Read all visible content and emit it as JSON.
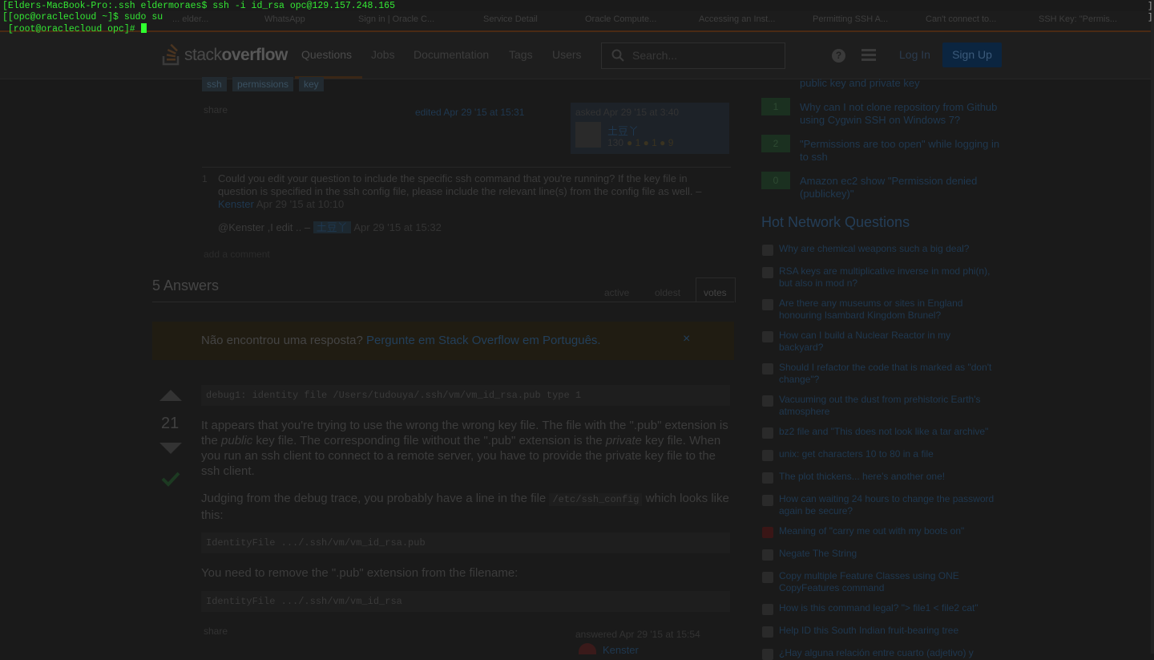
{
  "browser": {
    "tabs": [
      "... elder...",
      "WhatsApp",
      "Sign in | Oracle C...",
      "Service Detail",
      "Oracle Compute...",
      "Accessing an Inst...",
      "Permitting SSH A...",
      "Can't connect to...",
      "SSH Key: \"Permis..."
    ]
  },
  "so": {
    "logo_a": "stack",
    "logo_b": "overflow",
    "nav": [
      "Questions",
      "Jobs",
      "Documentation",
      "Tags",
      "Users"
    ],
    "search_placeholder": "Search...",
    "help_icon": "?",
    "login": "Log In",
    "signup": "Sign Up",
    "tags": [
      "ssh",
      "permissions",
      "key"
    ],
    "share": "share",
    "edited": "edited Apr 29 '15 at 15:31",
    "asked": "asked Apr 29 '15 at 3:40",
    "asker_name": "土豆丫",
    "asker_rep": "130",
    "asker_badges": "● 1  ● 1  ● 9",
    "comments": [
      {
        "score": "1",
        "text": "Could you edit your question to include the specific ssh command that you're running? If the key file in question is specified in the ssh config file, please include the relevant line(s) from the config file as well. –",
        "user": "Kenster",
        "time": "Apr 29 '15 at 10:10"
      },
      {
        "score": "",
        "text": "@Kenster ,I edit .. –",
        "user": "土豆丫",
        "time": "Apr 29 '15 at 15:32"
      }
    ],
    "add_comment": "add a comment",
    "answers_heading": "5 Answers",
    "sort": [
      "active",
      "oldest",
      "votes"
    ],
    "pt_text": "Não encontrou uma resposta?",
    "pt_link": "Pergunte em Stack Overflow em Português.",
    "pt_close": "×",
    "answer": {
      "votes": "21",
      "code1": "debug1: identity file /Users/tudouya/.ssh/vm/vm_id_rsa.pub type 1",
      "p1_a": "It appears that you're trying to use the wrong the wrong key file. The file with the \".pub\" extension is the ",
      "p1_b": "public",
      "p1_c": " key file. The corresponding file without the \".pub\" extension is the ",
      "p1_d": "private",
      "p1_e": " key file. When you run an ssh client to connect to a remote server, you have to provide the private key file to the ssh client.",
      "p2_a": "Judging from the debug trace, you probably have a line in the file ",
      "p2_code": "/etc/ssh_config",
      "p2_b": " which looks like this:",
      "code2": "IdentityFile .../.ssh/vm/vm_id_rsa.pub",
      "p3": "You need to remove the \".pub\" extension from the filename:",
      "code3": "IdentityFile .../.ssh/vm/vm_id_rsa",
      "share": "share",
      "answered": "answered Apr 29 '15 at 15:54",
      "answerer": "Kenster"
    }
  },
  "sidebar": {
    "related_top": "public key and private key",
    "related": [
      {
        "score": "1",
        "title": "Why can I not clone repository from Github using Cygwin SSH on Windows 7?"
      },
      {
        "score": "2",
        "title": "\"Permissions are too open\" while logging in to ssh"
      },
      {
        "score": "0",
        "title": "Amazon ec2 show \"Permission denied (publickey)\""
      }
    ],
    "hnq_heading": "Hot Network Questions",
    "hnq": [
      "Why are chemical weapons such a big deal?",
      "RSA keys are multiplicative inverse in mod phi(n), but also in mod n?",
      "Are there any museums or sites in England honouring Isambard Kingdom Brunel?",
      "How can I build a Nuclear Reactor in my backyard?",
      "Should I refactor the code that is marked as \"don't change\"?",
      "Vacuuming out the dust from prehistoric Earth's atmosphere",
      "bz2 file and \"This does not look like a tar archive\"",
      "unix: get characters 10 to 80 in a file",
      "The plot thickens... here's another one!",
      "How can waiting 24 hours to change the password again be secure?",
      "Meaning of \"carry me out with my boots on\"",
      "Negate The String",
      "Copy multiple Feature Classes using ONE CopyFeatures command",
      "How is this command legal? \"> file1 < file2 cat\"",
      "Help ID this South Indian fruit-bearing tree",
      "¿Hay alguna relación entre cuarto (adjetivo) y"
    ]
  },
  "terminal": {
    "line1": "[Elders-MacBook-Pro:.ssh eldermoraes$ ssh -i id_rsa opc@129.157.248.165",
    "line2": "[[opc@oraclecloud ~]$ sudo su",
    "line3": " [root@oraclecloud opc]# ",
    "right_bracket": "]"
  }
}
